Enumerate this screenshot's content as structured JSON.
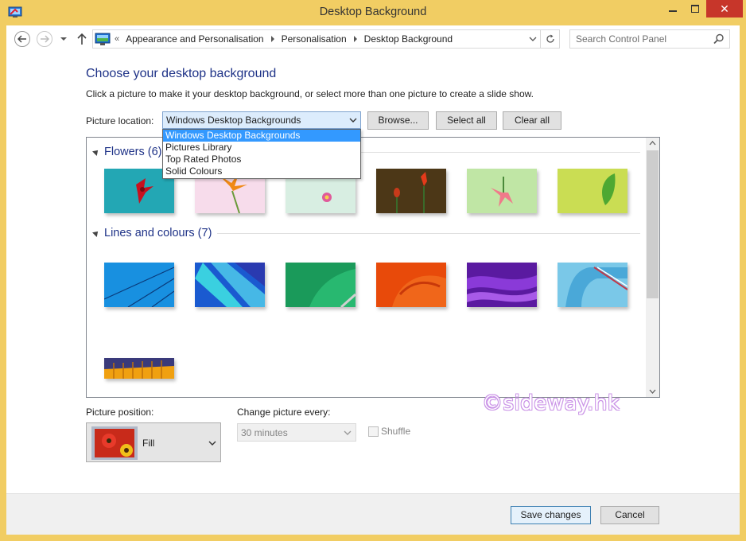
{
  "window": {
    "title": "Desktop Background",
    "close_glyph": "✕"
  },
  "address": {
    "overflow": "«",
    "crumbs": [
      "Appearance and Personalisation",
      "Personalisation",
      "Desktop Background"
    ]
  },
  "search": {
    "placeholder": "Search Control Panel"
  },
  "header": {
    "title": "Choose your desktop background",
    "description": "Click a picture to make it your desktop background, or select more than one picture to create a slide show."
  },
  "location": {
    "label": "Picture location:",
    "selected": "Windows Desktop Backgrounds",
    "options": [
      "Windows Desktop Backgrounds",
      "Pictures Library",
      "Top Rated Photos",
      "Solid Colours"
    ]
  },
  "buttons": {
    "browse": "Browse...",
    "select_all": "Select all",
    "clear_all": "Clear all",
    "save": "Save changes",
    "cancel": "Cancel"
  },
  "groups": [
    {
      "title": "Flowers (6)",
      "count": 6
    },
    {
      "title": "Lines and colours (7)",
      "count": 7
    }
  ],
  "position": {
    "label": "Picture position:",
    "value": "Fill"
  },
  "change": {
    "label": "Change picture every:",
    "value": "30 minutes"
  },
  "shuffle": {
    "label": "Shuffle",
    "checked": false,
    "enabled": false
  },
  "watermark": "©sideway.hk",
  "colors": {
    "frame": "#f1cd63",
    "heading": "#1e3287",
    "close_button": "#c7362a",
    "selection": "#3399ff"
  }
}
